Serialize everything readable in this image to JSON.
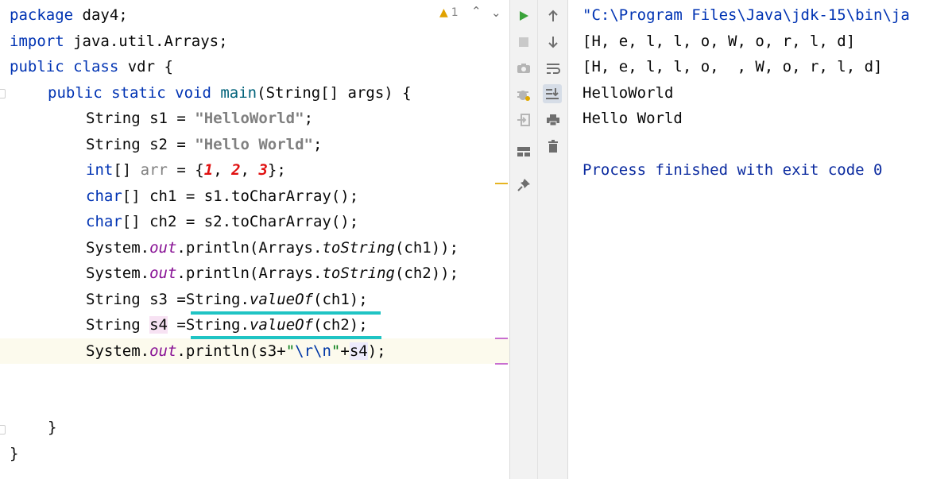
{
  "editor": {
    "inspection_count": "1",
    "nav_up": "^",
    "nav_down": "v",
    "line1": {
      "kw": "package",
      "rest": " day4;"
    },
    "line2": {
      "kw": "import",
      "rest": " java.util.Arrays;"
    },
    "line3": {
      "kw1": "public",
      "kw2": "class",
      "rest": " vdr {"
    },
    "line4": {
      "kw": "public static void",
      "method": "main",
      "rest": "(String[] args) {"
    },
    "line5": {
      "a": "String s1 = ",
      "s": "\"HelloWorld\"",
      "b": ";"
    },
    "line6": {
      "a": "String s2 = ",
      "s": "\"Hello World\"",
      "b": ";"
    },
    "line7": {
      "kw": "int",
      "a": "[] ",
      "var": "arr",
      "b": " = {",
      "n1": "1",
      "c1": ", ",
      "n2": "2",
      "c2": ", ",
      "n3": "3",
      "e": "};"
    },
    "line8": {
      "kw": "char",
      "rest": "[] ch1 = s1.toCharArray();"
    },
    "line9": {
      "kw": "char",
      "rest": "[] ch2 = s2.toCharArray();"
    },
    "line10": {
      "a": "System.",
      "f": "out",
      "b": ".println(Arrays.",
      "m": "toString",
      "c": "(ch1));"
    },
    "line11": {
      "a": "System.",
      "f": "out",
      "b": ".println(Arrays.",
      "m": "toString",
      "c": "(ch2));"
    },
    "line12": {
      "a": "String s3 =",
      "b": "String.",
      "m": "valueOf",
      "c": "(ch1);"
    },
    "line13": {
      "a": "String ",
      "v": "s4",
      "a2": " =",
      "b": "String.",
      "m": "valueOf",
      "c": "(ch2);"
    },
    "line14": {
      "a": "System.",
      "f": "out",
      "b": ".println(s3+",
      "q1": "\"",
      "esc": "\\r\\n",
      "q2": "\"",
      "p": "+",
      "v": "s4",
      "e": ");"
    },
    "line15": "}",
    "line16": "}"
  },
  "toolbar_left": {
    "icons": [
      "run-icon",
      "stop-icon",
      "camera-icon",
      "debug-icon",
      "exit-icon",
      "layout-icon",
      "pin-icon"
    ]
  },
  "toolbar_right": {
    "icons": [
      "up-arrow-icon",
      "down-arrow-icon",
      "soft-wrap-icon",
      "scroll-to-end-icon",
      "print-icon",
      "trash-icon"
    ]
  },
  "console": {
    "lines": [
      "\"C:\\Program Files\\Java\\jdk-15\\bin\\ja",
      "[H, e, l, l, o, W, o, r, l, d]",
      "[H, e, l, l, o,  , W, o, r, l, d]",
      "HelloWorld",
      "Hello World",
      "",
      "Process finished with exit code 0"
    ]
  },
  "colors": {
    "keyword": "#0033b3",
    "string": "#808080",
    "number": "#e01010",
    "field": "#871094",
    "underline": "#1fc4c4",
    "run": "#3aa33a"
  }
}
